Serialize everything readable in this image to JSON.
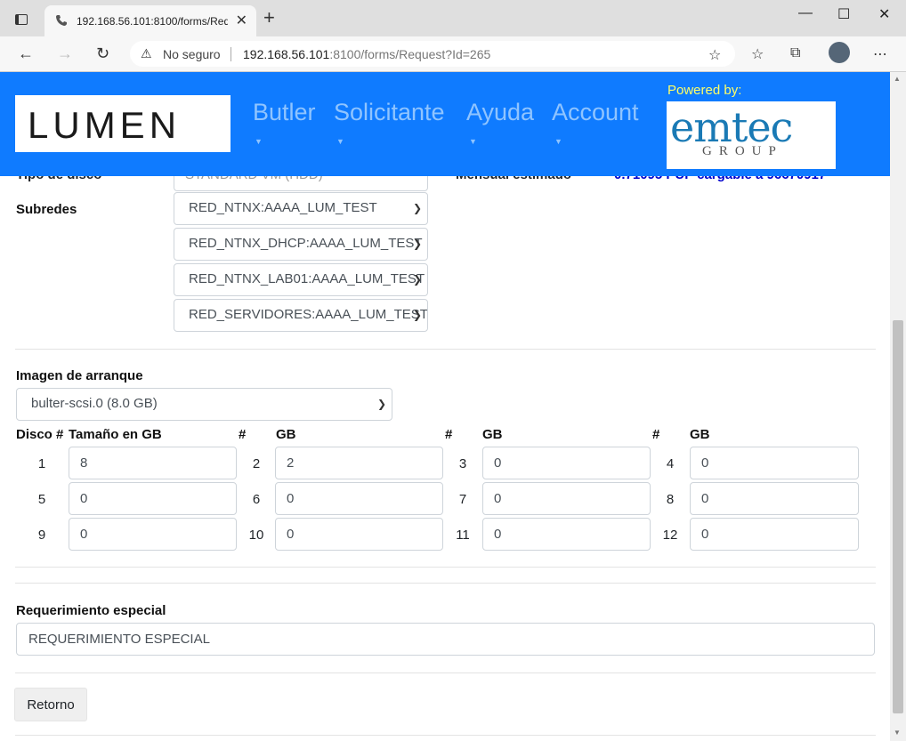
{
  "browser": {
    "tab_title": "192.168.56.101:8100/forms/Requ",
    "security_text": "No seguro",
    "url_host": "192.168.56.101",
    "url_rest": ":8100/forms/Request?Id=265"
  },
  "header": {
    "logo_text": "LUMEN",
    "nav": [
      "Butler",
      "Solicitante",
      "Ayuda",
      "Account"
    ],
    "powered_by": "Powered by:",
    "partner_logo_name": "emtec",
    "partner_logo_sub": "GROUP"
  },
  "hidden_row": {
    "label": "Tipo de disco",
    "value": "STANDARD VM (HDD)",
    "label2": "Mensual estimado",
    "value2": "0.71095 PUP cargable a 96670917"
  },
  "subredes": {
    "label": "Subredes",
    "options": [
      "RED_NTNX:AAAA_LUM_TEST",
      "RED_NTNX_DHCP:AAAA_LUM_TEST",
      "RED_NTNX_LAB01:AAAA_LUM_TEST",
      "RED_SERVIDORES:AAAA_LUM_TEST"
    ]
  },
  "boot": {
    "label": "Imagen de arranque",
    "selected": "bulter-scsi.0 (8.0 GB)"
  },
  "disks": {
    "header_num_first": "Disco #",
    "header_size_first": "Tamaño en GB",
    "header_num": "#",
    "header_size": "GB",
    "items": [
      {
        "n": "1",
        "gb": "8"
      },
      {
        "n": "2",
        "gb": "2"
      },
      {
        "n": "3",
        "gb": "0"
      },
      {
        "n": "4",
        "gb": "0"
      },
      {
        "n": "5",
        "gb": "0"
      },
      {
        "n": "6",
        "gb": "0"
      },
      {
        "n": "7",
        "gb": "0"
      },
      {
        "n": "8",
        "gb": "0"
      },
      {
        "n": "9",
        "gb": "0"
      },
      {
        "n": "10",
        "gb": "0"
      },
      {
        "n": "11",
        "gb": "0"
      },
      {
        "n": "12",
        "gb": "0"
      }
    ]
  },
  "special": {
    "label": "Requerimiento especial",
    "value": "REQUERIMIENTO ESPECIAL"
  },
  "actions": {
    "back_label": "Retorno"
  }
}
